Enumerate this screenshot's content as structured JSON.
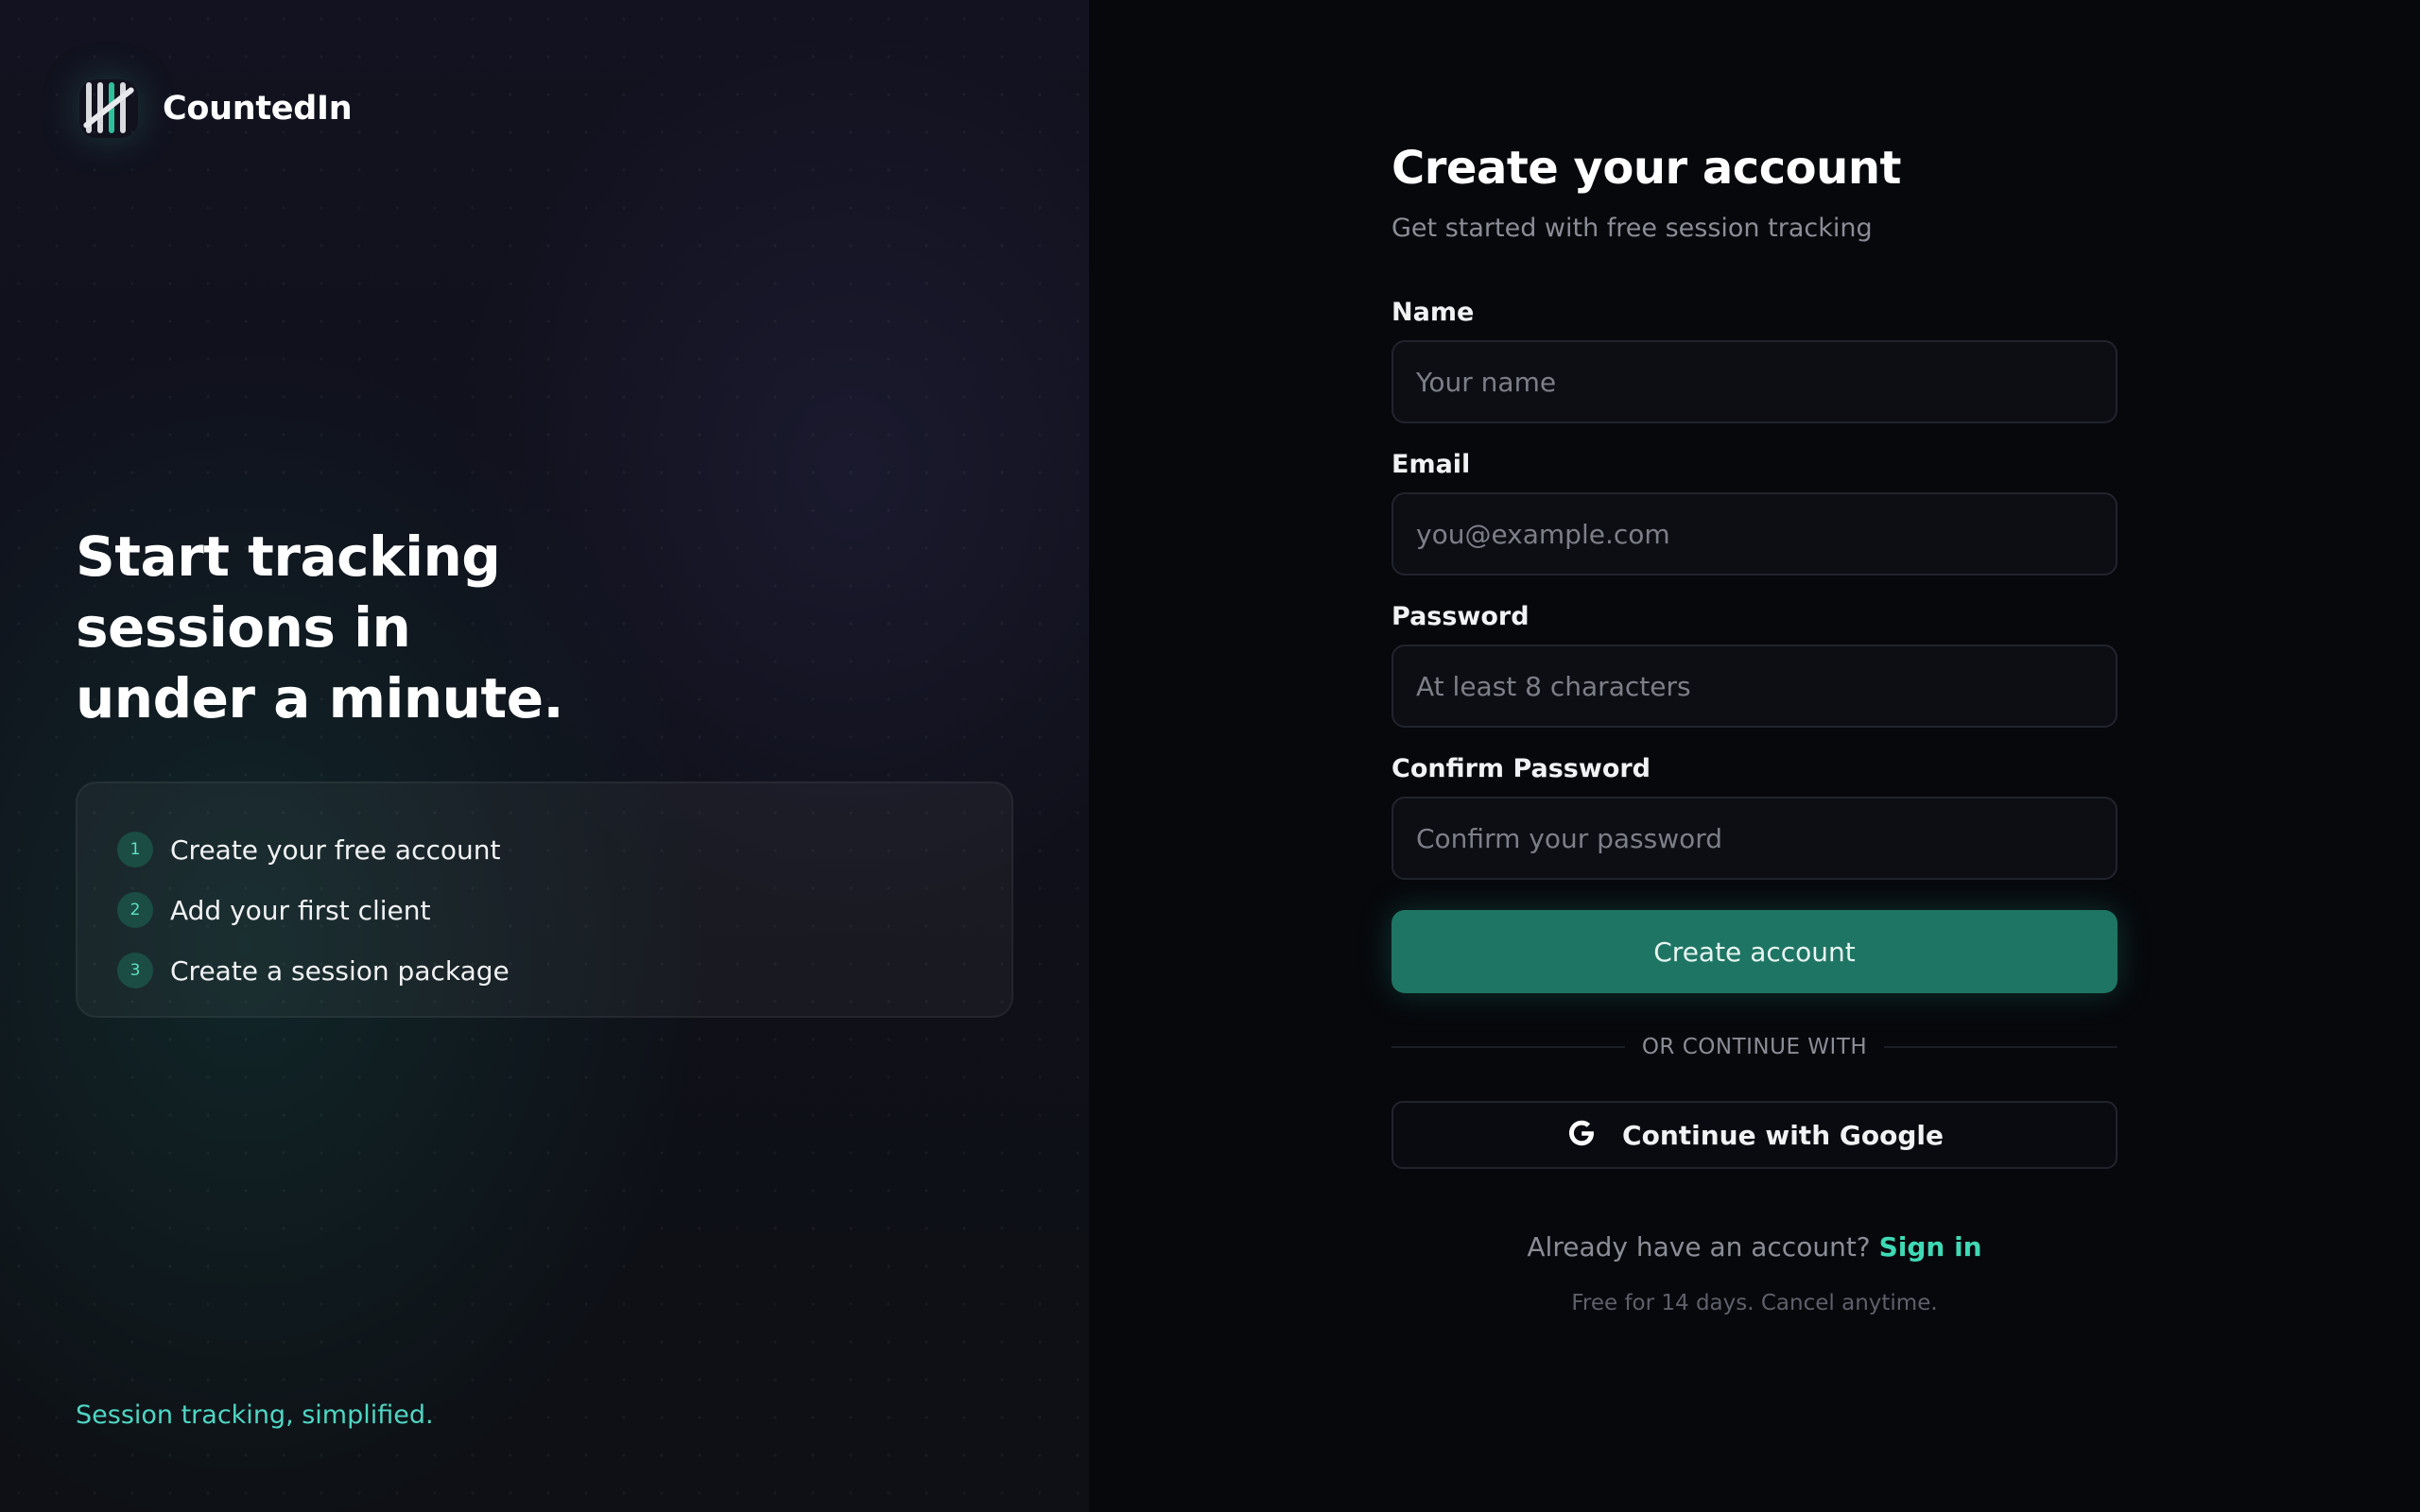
{
  "brand": {
    "name": "CountedIn",
    "icon": "tally-marks-icon"
  },
  "hero": {
    "headline_line1": "Start tracking",
    "headline_line2": "sessions in",
    "headline_line3": "under a minute.",
    "steps": [
      {
        "number": "1",
        "label": "Create your free account"
      },
      {
        "number": "2",
        "label": "Add your first client"
      },
      {
        "number": "3",
        "label": "Create a session package"
      }
    ],
    "tagline": "Session tracking, simplified."
  },
  "form": {
    "title": "Create your account",
    "subtitle": "Get started with free session tracking",
    "name_label": "Name",
    "name_placeholder": "Your name",
    "email_label": "Email",
    "email_placeholder": "you@example.com",
    "password_label": "Password",
    "password_placeholder": "At least 8 characters",
    "confirm_label": "Confirm Password",
    "confirm_placeholder": "Confirm your password",
    "submit_label": "Create account",
    "divider_text": "OR CONTINUE WITH",
    "google_label": "Continue with Google",
    "google_icon": "google-icon",
    "signin_prompt": "Already have an account?",
    "signin_link": "Sign in",
    "fine_print": "Free for 14 days. Cancel anytime."
  },
  "colors": {
    "accent": "#1f7564",
    "link": "#3fd9b5",
    "tagline": "#4fd6c3",
    "background": "#07080c"
  }
}
